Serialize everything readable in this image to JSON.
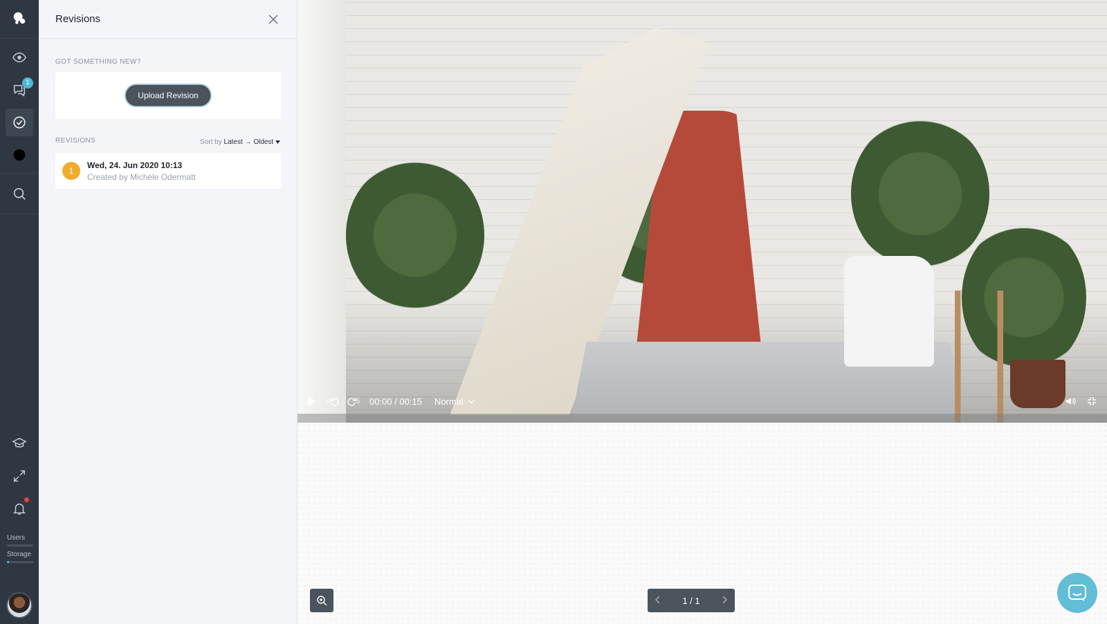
{
  "rail": {
    "badge_count": "1",
    "usage": [
      {
        "label": "Users",
        "fill_fraction": 0
      },
      {
        "label": "Storage",
        "fill_fraction": 0.08
      }
    ]
  },
  "panel": {
    "title": "Revisions",
    "upload_section_label": "GOT SOMETHING NEW?",
    "upload_button": "Upload Revision",
    "revisions_label": "REVISIONS",
    "sort_prefix": "Sort by",
    "sort_value": "Latest → Oldest",
    "revisions": [
      {
        "number": "1",
        "date": "Wed, 24. Jun 2020 10:13",
        "author": "Created by Michèle Odermatt"
      }
    ]
  },
  "player": {
    "time": "00:00 / 00:15",
    "speed": "Normal",
    "progress_fraction": 0,
    "skip_back": "5",
    "skip_forward": "5"
  },
  "pager": {
    "label": "1 / 1"
  },
  "colors": {
    "accent": "#4fb8d8",
    "revision_badge": "#f0ac2c",
    "rail_bg": "#2f3742",
    "notification": "#e8423a"
  }
}
